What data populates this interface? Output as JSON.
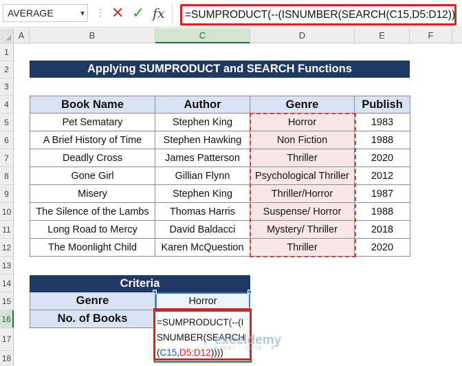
{
  "formula_bar": {
    "name_box": "AVERAGE",
    "cancel_icon": "✕",
    "enter_icon": "✓",
    "fx_label": "fx",
    "formula": "=SUMPRODUCT(--(ISNUMBER(SEARCH(C15,D5:D12))))"
  },
  "columns": [
    "A",
    "B",
    "C",
    "D",
    "E",
    "F"
  ],
  "rows": [
    "1",
    "2",
    "3",
    "4",
    "5",
    "6",
    "7",
    "8",
    "9",
    "10",
    "11",
    "12",
    "13",
    "14",
    "15",
    "16",
    "17",
    "18"
  ],
  "title": "Applying SUMPRODUCT and SEARCH Functions",
  "table": {
    "headers": [
      "Book Name",
      "Author",
      "Genre",
      "Publish"
    ],
    "rows": [
      [
        "Pet Sematary",
        "Stephen King",
        "Horror",
        "1983"
      ],
      [
        "A Brief History of Time",
        "Stephen Hawking",
        "Non Fiction",
        "1988"
      ],
      [
        "Deadly Cross",
        "James Patterson",
        "Thriller",
        "2020"
      ],
      [
        "Gone Girl",
        "Gillian Flynn",
        "Psychological Thriller",
        "2012"
      ],
      [
        "Misery",
        "Stephen King",
        "Thriller/Horror",
        "1987"
      ],
      [
        "The Silence of the Lambs",
        "Thomas Harris",
        "Suspense/ Horror",
        "1988"
      ],
      [
        "Long Road to Mercy",
        "David Baldacci",
        "Mystery/ Thriller",
        "2018"
      ],
      [
        "The Moonlight Child",
        "Karen McQuestion",
        "Thriller",
        "2020"
      ]
    ]
  },
  "criteria": {
    "title": "Criteria",
    "genre_label": "Genre",
    "genre_value": "Horror",
    "books_label": "No. of Books",
    "edit_part1": "=SUMPRODUCT(--(",
    "edit_part2": "ISNUMBER(SEARCH(",
    "edit_ref1": "C15",
    "edit_comma": ",",
    "edit_ref2": "D5:D12",
    "edit_close": "))))"
  },
  "watermark": {
    "name": "exceldemy",
    "tagline": "EXCEL · DATA · BI"
  },
  "colors": {
    "header_navy": "#203864",
    "header_blue": "#dae3f3",
    "genre_fill": "#f9e7e7",
    "highlight_red": "#e02020",
    "excel_green": "#217346"
  }
}
